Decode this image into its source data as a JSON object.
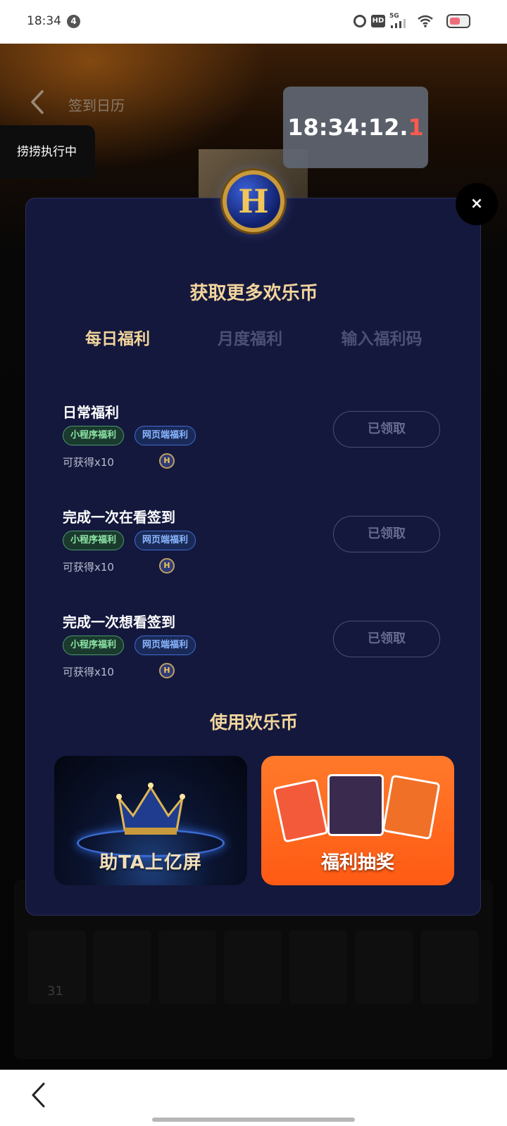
{
  "status_bar": {
    "time": "18:34",
    "notification_count": "4",
    "hd": "HD",
    "network": "5G"
  },
  "page": {
    "title": "签到日历",
    "executing_badge": "捞捞执行中",
    "timer_main": "18:34:12.",
    "timer_tenth": "1",
    "calendar_day": "31"
  },
  "modal": {
    "title": "获取更多欢乐币",
    "tabs": [
      {
        "label": "每日福利",
        "active": true
      },
      {
        "label": "月度福利",
        "active": false
      },
      {
        "label": "输入福利码",
        "active": false
      }
    ],
    "tasks": [
      {
        "name": "日常福利",
        "tags": [
          "小程序福利",
          "网页端福利"
        ],
        "reward": "可获得x10",
        "button": "已领取"
      },
      {
        "name": "完成一次在看签到",
        "tags": [
          "小程序福利",
          "网页端福利"
        ],
        "reward": "可获得x10",
        "button": "已领取"
      },
      {
        "name": "完成一次想看签到",
        "tags": [
          "小程序福利",
          "网页端福利"
        ],
        "reward": "可获得x10",
        "button": "已领取"
      }
    ],
    "use_title": "使用欢乐币",
    "banners": [
      {
        "label": "助TA上亿屏"
      },
      {
        "label": "福利抽奖"
      }
    ],
    "coin_letter": "H",
    "close_symbol": "×"
  },
  "colors": {
    "modal_bg": "#14183d",
    "accent_gold": "#f2d59c",
    "lottery_orange": "#ff6a1f"
  }
}
